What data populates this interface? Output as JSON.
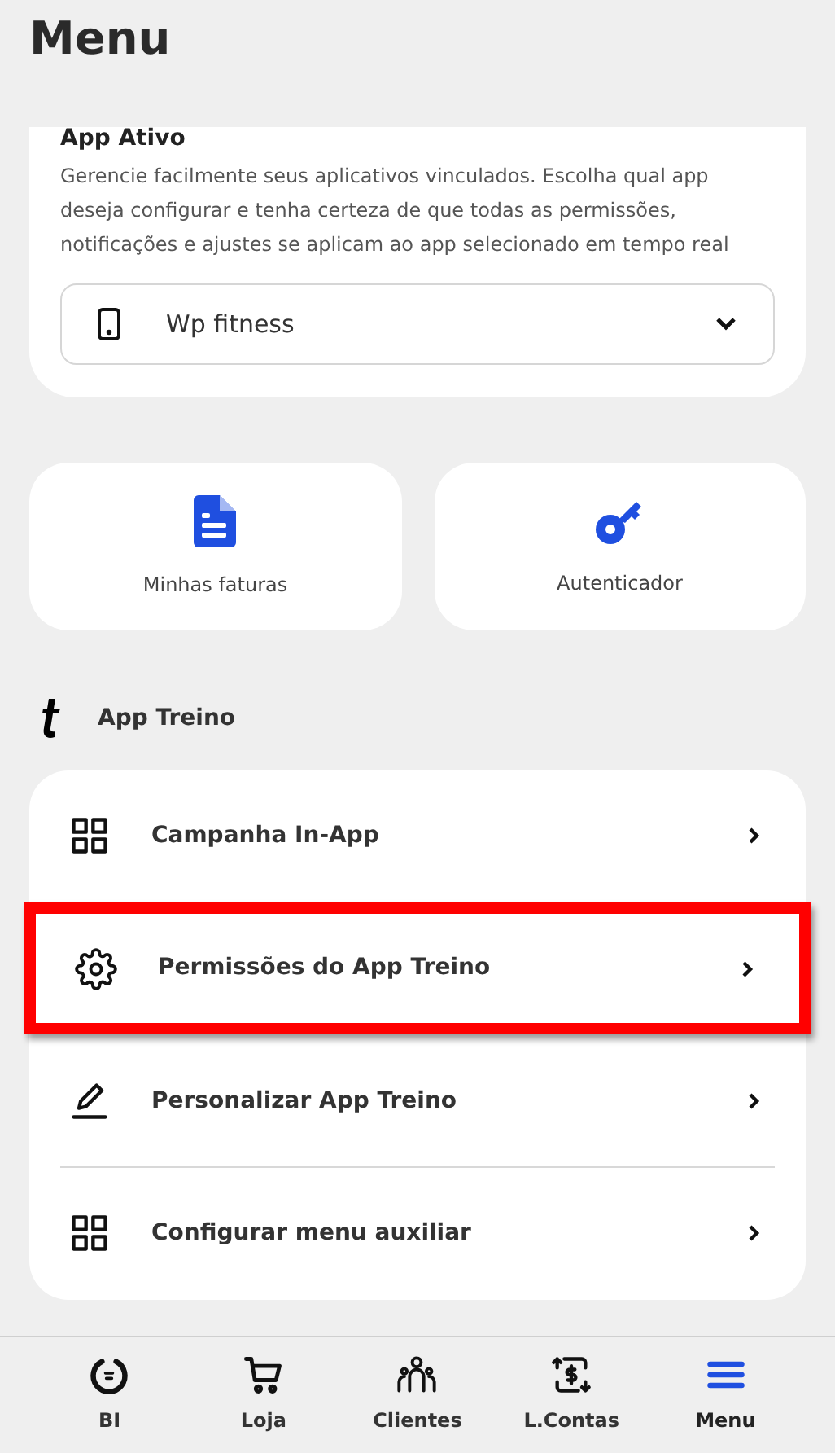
{
  "header": {
    "title": "Menu"
  },
  "active_app": {
    "title": "App Ativo",
    "description": "Gerencie facilmente seus aplicativos vinculados. Escolha qual app deseja configurar e tenha certeza de que todas as permissões, notificações e ajustes se aplicam ao app selecionado em tempo real",
    "select": {
      "value": "Wp fitness"
    }
  },
  "tiles": [
    {
      "kind": "invoice",
      "label": "Minhas faturas"
    },
    {
      "kind": "key",
      "label": "Autenticador"
    }
  ],
  "section": {
    "title": "App Treino"
  },
  "menu_items": [
    {
      "kind": "grid",
      "label": "Campanha In-App",
      "highlighted": false,
      "divider": false
    },
    {
      "kind": "gear",
      "label": "Permissões do App Treino",
      "highlighted": true,
      "divider": false
    },
    {
      "kind": "pencil",
      "label": "Personalizar App Treino",
      "highlighted": false,
      "divider": true
    },
    {
      "kind": "grid",
      "label": "Configurar menu auxiliar",
      "highlighted": false,
      "divider": false
    }
  ],
  "bottom_nav": [
    {
      "kind": "bi",
      "label": "BI",
      "selected": false
    },
    {
      "kind": "cart",
      "label": "Loja",
      "selected": false
    },
    {
      "kind": "people",
      "label": "Clientes",
      "selected": false
    },
    {
      "kind": "money",
      "label": "L.Contas",
      "selected": false
    },
    {
      "kind": "menu",
      "label": "Menu",
      "selected": true
    }
  ]
}
